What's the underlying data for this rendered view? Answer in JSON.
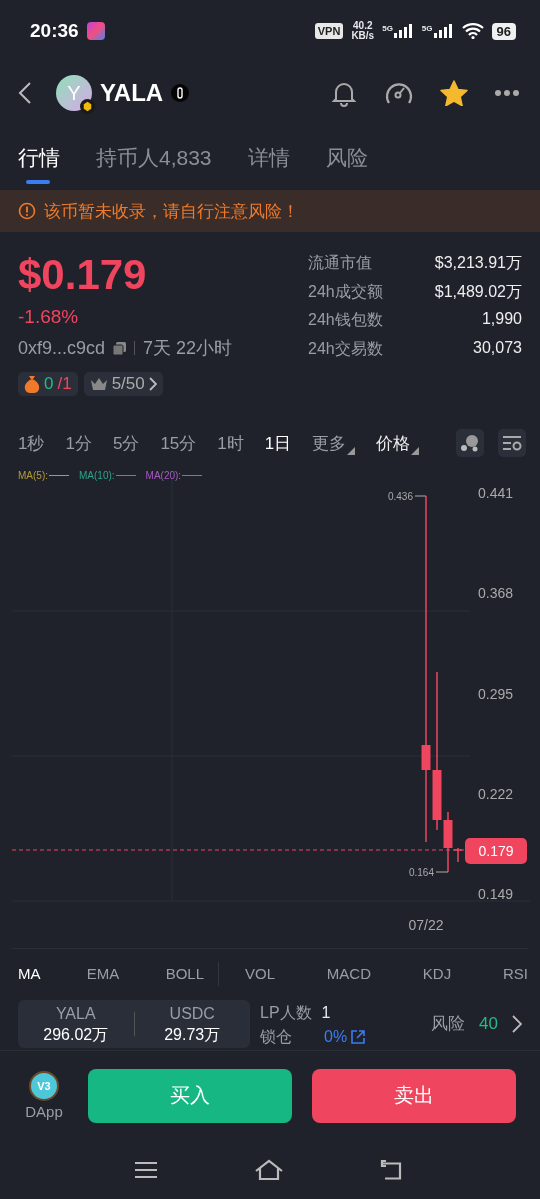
{
  "status_bar": {
    "time": "20:36",
    "vpn": "VPN",
    "speed": "40.2",
    "speed_unit": "KB/s",
    "net_1": "5G",
    "net_2": "5G",
    "battery": "96"
  },
  "header": {
    "avatar_letter": "Y",
    "title": "YALA",
    "favorited": true
  },
  "tabs": [
    {
      "label": "行情",
      "selected": true
    },
    {
      "label": "持币人4,833",
      "selected": false
    },
    {
      "label": "详情",
      "selected": false
    },
    {
      "label": "风险",
      "selected": false
    }
  ],
  "warning": "该币暂未收录，请自行注意风险！",
  "price": {
    "value": "$0.179",
    "change": "-1.68%",
    "address": "0xf9...c9cd",
    "age": "7天 22小时"
  },
  "stats": [
    {
      "label": "流通市值",
      "value": "$3,213.91万"
    },
    {
      "label": "24h成交额",
      "value": "$1,489.02万"
    },
    {
      "label": "24h钱包数",
      "value": "1,990"
    },
    {
      "label": "24h交易数",
      "value": "30,073"
    }
  ],
  "money_badge": {
    "good": "0",
    "bad": "/1"
  },
  "rank_badge": {
    "text": "5/50"
  },
  "timeframes": [
    {
      "label": "1秒",
      "selected": false
    },
    {
      "label": "1分",
      "selected": false
    },
    {
      "label": "5分",
      "selected": false
    },
    {
      "label": "15分",
      "selected": false
    },
    {
      "label": "1时",
      "selected": false
    },
    {
      "label": "1日",
      "selected": true
    },
    {
      "label": "更多",
      "selected": false
    }
  ],
  "price_mode": "价格",
  "chart": {
    "legend": [
      {
        "label": "MA(5):",
        "color": "#b59a3a"
      },
      {
        "label": "MA(10):",
        "color": "#2aa58a"
      },
      {
        "label": "MA(20):",
        "color": "#a55bc0"
      }
    ],
    "yticks": [
      "0.441",
      "0.368",
      "0.295",
      "0.222",
      "0.149"
    ],
    "xtick": "07/22",
    "high_label": "0.436",
    "low_label": "0.164",
    "price_tag": "0.179"
  },
  "main_indicators": [
    {
      "label": "MA",
      "selected": true
    },
    {
      "label": "EMA",
      "selected": false
    },
    {
      "label": "BOLL",
      "selected": false
    }
  ],
  "sub_indicators": [
    {
      "label": "VOL",
      "selected": false
    },
    {
      "label": "MACD",
      "selected": false
    },
    {
      "label": "KDJ",
      "selected": false
    },
    {
      "label": "RSI",
      "selected": false
    }
  ],
  "pool": {
    "base_symbol": "YALA",
    "base_amount": "296.02万",
    "quote_symbol": "USDC",
    "quote_amount": "29.73万",
    "lp_label": "LP人数",
    "lp_value": "1",
    "lock_label": "锁仓",
    "lock_value": "0%",
    "risk_label": "风险",
    "risk_value": "40"
  },
  "actions": {
    "dapp_badge": "V3",
    "dapp_label": "DApp",
    "buy": "买入",
    "sell": "卖出"
  }
}
